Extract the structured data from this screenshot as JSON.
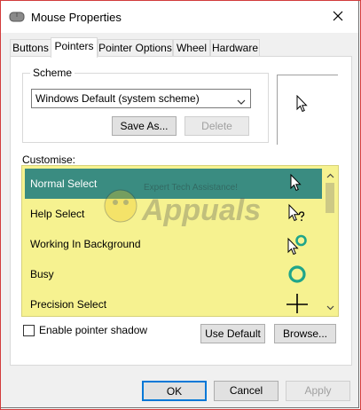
{
  "window": {
    "title": "Mouse Properties"
  },
  "icons": {
    "app": "mouse-icon",
    "close": "close-icon"
  },
  "tabs": [
    {
      "label": "Buttons",
      "active": false
    },
    {
      "label": "Pointers",
      "active": true
    },
    {
      "label": "Pointer Options",
      "active": false
    },
    {
      "label": "Wheel",
      "active": false
    },
    {
      "label": "Hardware",
      "active": false
    }
  ],
  "scheme": {
    "group_label": "Scheme",
    "selected": "Windows Default (system scheme)",
    "save_as_label": "Save As...",
    "delete_label": "Delete"
  },
  "customise": {
    "label": "Customise:",
    "rows": [
      {
        "label": "Normal Select",
        "cursor": "arrow-cursor-icon",
        "selected": true
      },
      {
        "label": "Help Select",
        "cursor": "help-cursor-icon",
        "selected": false
      },
      {
        "label": "Working In Background",
        "cursor": "working-cursor-icon",
        "selected": false
      },
      {
        "label": "Busy",
        "cursor": "busy-cursor-icon",
        "selected": false
      },
      {
        "label": "Precision Select",
        "cursor": "crosshair-cursor-icon",
        "selected": false
      }
    ]
  },
  "watermark": {
    "tagline": "Expert Tech Assistance!",
    "brand": "Appuals"
  },
  "shadow": {
    "label": "Enable pointer shadow",
    "checked": false
  },
  "buttons": {
    "use_default": "Use Default",
    "browse": "Browse...",
    "ok": "OK",
    "cancel": "Cancel",
    "apply": "Apply"
  },
  "colors": {
    "selection": "#3a8c81",
    "highlight": "#f6f290",
    "ok_border": "#0078d7",
    "busy_ring": "#1fa58a"
  }
}
